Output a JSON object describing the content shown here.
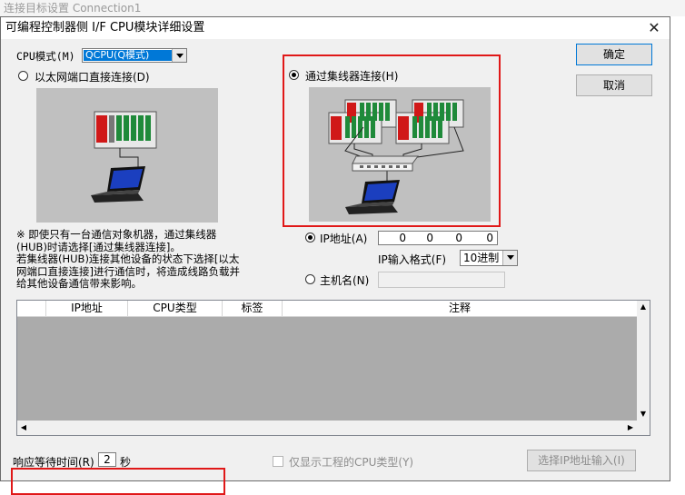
{
  "background_title": "连接目标设置 Connection1",
  "dialog": {
    "title": "可编程控制器侧 I/F CPU模块详细设置",
    "close_glyph": "✕",
    "ok_label": "确定",
    "cancel_label": "取消"
  },
  "cpu_mode": {
    "label": "CPU模式(M)",
    "selected": "QCPU(Q模式)"
  },
  "direct_option": {
    "label": "以太网端口直接连接(D)",
    "selected": false
  },
  "hub_option": {
    "label": "通过集线器连接(H)",
    "selected": true
  },
  "note_text": "※ 即使只有一台通信对象机器，通过集线器(HUB)时请选择[通过集线器连接]。\n若集线器(HUB)连接其他设备的状态下选择[以太网端口直接连接]进行通信时，将造成线路负载并给其他设备通信带来影响。",
  "ip_address": {
    "label": "IP地址(A)",
    "selected": true,
    "octets": [
      "0",
      "0",
      "0",
      "0"
    ]
  },
  "ip_format": {
    "label": "IP输入格式(F)",
    "selected": "10进制"
  },
  "host_name": {
    "label": "主机名(N)",
    "selected": false,
    "value": ""
  },
  "table": {
    "columns": [
      "IP地址",
      "CPU类型",
      "标签",
      "注释"
    ],
    "rows": []
  },
  "timeout": {
    "label": "响应等待时间(R)",
    "value": "2",
    "unit": "秒"
  },
  "show_project_cpu": {
    "label": "仅显示工程的CPU类型(Y)",
    "checked": false
  },
  "select_ip_button": {
    "label": "选择IP地址输入(I)"
  },
  "colors": {
    "highlight": "#e01818",
    "selection": "#0078d7"
  }
}
